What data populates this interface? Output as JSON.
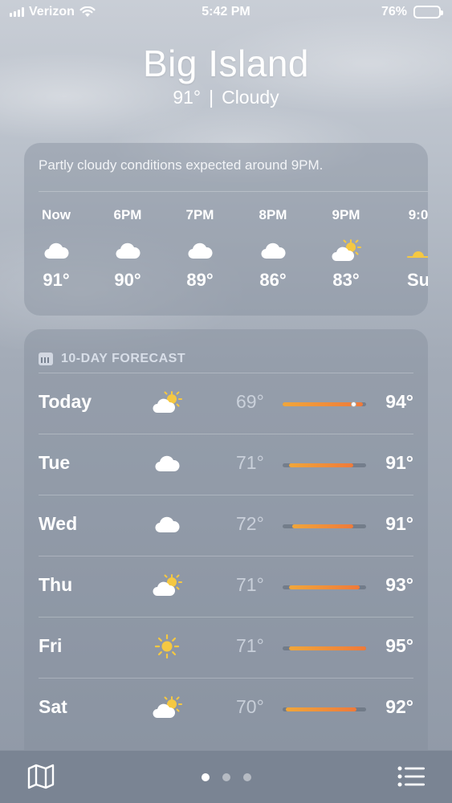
{
  "status_bar": {
    "carrier": "Verizon",
    "time": "5:42 PM",
    "battery_percent": "76%",
    "battery_level": 0.76,
    "icons": [
      "signal-icon",
      "wifi-icon",
      "battery-icon"
    ]
  },
  "location": {
    "city": "Big Island",
    "current_temp": "91°",
    "separator": "|",
    "condition": "Cloudy"
  },
  "hourly_card": {
    "caption": "Partly cloudy conditions expected around 9PM.",
    "hours": [
      {
        "label": "Now",
        "icon": "cloud-icon",
        "temp": "91°"
      },
      {
        "label": "6PM",
        "icon": "cloud-icon",
        "temp": "90°"
      },
      {
        "label": "7PM",
        "icon": "cloud-icon",
        "temp": "89°"
      },
      {
        "label": "8PM",
        "icon": "cloud-icon",
        "temp": "86°"
      },
      {
        "label": "9PM",
        "icon": "partly-sunny-icon",
        "temp": "83°"
      },
      {
        "label": "9:0",
        "icon": "sunset-icon",
        "temp": "Su"
      }
    ]
  },
  "daily_card": {
    "header": "10-DAY FORECAST",
    "header_icon": "calendar-icon",
    "scale_min": 69,
    "scale_max": 95,
    "days": [
      {
        "day": "Today",
        "icon": "partly-sunny-icon",
        "low": "69°",
        "high": "94°",
        "low_value": 69,
        "high_value": 94,
        "current_value": 91
      },
      {
        "day": "Tue",
        "icon": "cloud-icon",
        "low": "71°",
        "high": "91°",
        "low_value": 71,
        "high_value": 91
      },
      {
        "day": "Wed",
        "icon": "cloud-icon",
        "low": "72°",
        "high": "91°",
        "low_value": 72,
        "high_value": 91
      },
      {
        "day": "Thu",
        "icon": "partly-sunny-icon",
        "low": "71°",
        "high": "93°",
        "low_value": 71,
        "high_value": 93
      },
      {
        "day": "Fri",
        "icon": "sun-icon",
        "low": "71°",
        "high": "95°",
        "low_value": 71,
        "high_value": 95
      },
      {
        "day": "Sat",
        "icon": "partly-sunny-icon",
        "low": "70°",
        "high": "92°",
        "low_value": 70,
        "high_value": 92
      }
    ]
  },
  "tab_bar": {
    "page_count": 3,
    "active_page": 0,
    "icons": [
      "map-icon",
      "list-icon"
    ]
  }
}
